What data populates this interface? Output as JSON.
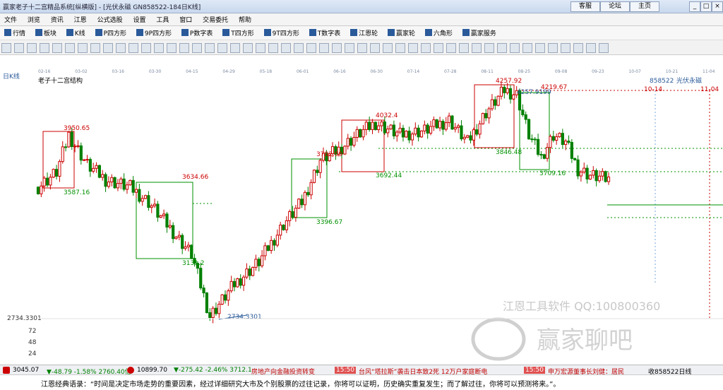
{
  "window": {
    "title": "赢家老子十二宫精品系统[纵横版] - [光伏永磁  GN858522-184日K线]",
    "buttons": [
      "客服",
      "论坛",
      "主页"
    ],
    "controls": [
      "_",
      "□",
      "×"
    ]
  },
  "menu": [
    "文件",
    "浏览",
    "资讯",
    "江恩",
    "公式选股",
    "设置",
    "工具",
    "窗口",
    "交易委托",
    "帮助"
  ],
  "toolbar1": [
    {
      "icon": "quote-icon",
      "label": "行情"
    },
    {
      "icon": "board-icon",
      "label": "板块"
    },
    {
      "icon": "kline-icon",
      "label": "K线"
    },
    {
      "icon": "p-square-icon",
      "label": "P四方形"
    },
    {
      "icon": "9p-square-icon",
      "label": "9P四方形"
    },
    {
      "icon": "p-table-icon",
      "label": "P数字表"
    },
    {
      "icon": "t-square-icon",
      "label": "T四方形"
    },
    {
      "icon": "9t-square-icon",
      "label": "9T四方形"
    },
    {
      "icon": "t-table-icon",
      "label": "T数字表"
    },
    {
      "icon": "gann-wheel-icon",
      "label": "江恩轮"
    },
    {
      "icon": "winner-wheel-icon",
      "label": "赢家轮"
    },
    {
      "icon": "hexagon-icon",
      "label": "六角形"
    },
    {
      "icon": "service-icon",
      "label": "赢家服务"
    }
  ],
  "chart": {
    "period_label": "日K线",
    "indicator_name": "老子十二宫结构",
    "stock_code": "858522",
    "stock_name": "光伏永磁",
    "dates": [
      "02-16",
      "03-02",
      "03-16",
      "03-30",
      "04-15",
      "04-29",
      "05-18",
      "06-01",
      "06-16",
      "06-30",
      "07-14",
      "07-28",
      "08-11",
      "08-25",
      "09-08",
      "09-23",
      "10-07",
      "10-21",
      "11-04"
    ],
    "y_axis_labels": [
      "2734.3301",
      "72",
      "48",
      "24"
    ],
    "price_annotations": [
      "3950.65",
      "3587.16",
      "3634.66",
      "3131.2",
      "2734.3301",
      "3782.09",
      "3396.67",
      "4032.4",
      "3692.44",
      "4257.92",
      "3846.48",
      "4257.9199",
      "3709.16",
      "4219.67"
    ],
    "future_dates": [
      "10-14",
      "11-04"
    ],
    "watermark_line1": "江恩工具软件  QQ:100800360",
    "watermark_line2": "赢家聊吧"
  },
  "chart_data": {
    "type": "candlestick",
    "title": "老子十二宫结构",
    "xlabel": "",
    "ylabel": "",
    "x": [
      "02-16",
      "03-02",
      "03-16",
      "03-30",
      "04-15",
      "04-29",
      "05-18",
      "06-01",
      "06-16",
      "06-30",
      "07-14",
      "07-28",
      "08-11",
      "08-25",
      "09-08",
      "09-23",
      "10-07",
      "10-21",
      "11-04"
    ],
    "ylim": [
      2700,
      4300
    ],
    "boxes": [
      {
        "high": 3950.65,
        "low": 3587.16,
        "color": "red"
      },
      {
        "high": 3634.66,
        "low": 3131.2,
        "color": "green"
      },
      {
        "high": 3782.09,
        "low": 3396.67,
        "color": "green"
      },
      {
        "high": 4032.4,
        "low": 3692.44,
        "color": "red"
      },
      {
        "high": 4257.92,
        "low": 3846.48,
        "color": "red"
      },
      {
        "high": 4257.9199,
        "low": 3709.16,
        "color": "green"
      }
    ],
    "low_point": 2734.3301,
    "levels": [
      4219.67
    ]
  },
  "ticker": [
    {
      "text": "3045.07",
      "color": "#000"
    },
    {
      "text": "▼-48.79  -1.58%  2760.40亿",
      "color": "#008000"
    },
    {
      "text": "10899.70",
      "color": "#000"
    },
    {
      "text": "▼-275.42  -2.46%  3712.1",
      "color": "#008000"
    },
    {
      "text": "房地产向金融投资转变",
      "color": "#c00000"
    },
    {
      "text": "15:50",
      "color": "#fff"
    },
    {
      "text": "台风“塔拉斯”袭击日本致2死 12万户家庭断电",
      "color": "#c00000"
    },
    {
      "text": "15:50",
      "color": "#fff"
    },
    {
      "text": "申万宏源董事长刘健：居民",
      "color": "#c00000"
    },
    {
      "text": "收858522日线",
      "color": "#000"
    }
  ],
  "quote": "江恩经典语录：“时间是决定市场走势的重要因素，经过详细研究大市及个别股票的过往记录，你将可以证明，历史确实重复发生；而了解过往，你将可以预测将来。”。"
}
